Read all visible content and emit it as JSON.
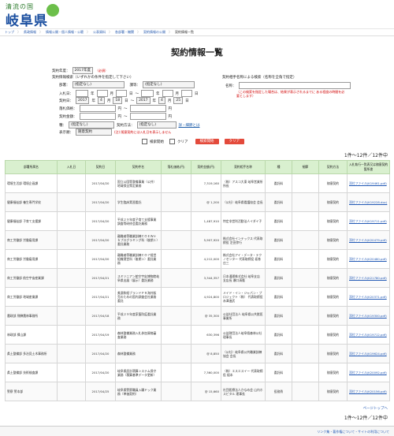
{
  "header": {
    "logo_small": "清流の国",
    "logo_big": "岐阜県"
  },
  "breadcrumb": [
    "トップ",
    "県政情報",
    "情報公開・個人情報・公聴",
    "公表資料",
    "各部署・機関",
    "契約情報の公開",
    "契約情報一覧"
  ],
  "page_title": "契約情報一覧",
  "form": {
    "year_label": "契約年度：",
    "year_value": "2017年度",
    "year_required": "（必須）",
    "cond_title": "契約情報検索（いずれかの条件を指定して下さい）",
    "dept_label": "部署：",
    "dept_value": "(指定なし)",
    "sect_label": "課等：",
    "sect_value": "(指定なし)",
    "enter_label": "入札日：",
    "contract_label": "契約日：",
    "date_from": [
      "2017",
      "4",
      "18"
    ],
    "date_to": [
      "2017",
      "4",
      "25"
    ],
    "year_unit": "年",
    "month_unit": "月",
    "day_unit": "日",
    "tilde": "〜",
    "bid_label": "落札価格：",
    "contract_amount_label": "契約金額：",
    "yen": "円",
    "type_label": "種：",
    "type_value": "(指定なし)",
    "method_label": "契約方法：",
    "method_value": "(指定なし)",
    "detail_link": "詳・細節とは",
    "sort_label": "表示順：",
    "sort_value": "随意契約",
    "sort_note": "(注) 随意契約には入札日を表示しません",
    "partner_title": "契約相手名称による検索（名称を全角で指定）",
    "partner_label": "名称：",
    "partner_note": "（この検索を指定した場合は、結果が表示されるまでに ある程度の時間を必要とします）",
    "check_search": "検索開始",
    "check_clear": "クリア",
    "search_button": "検索開始",
    "clear_button": "クリア"
  },
  "result_count": "1件〜12件／12件中",
  "table": {
    "headers": [
      "部署所属名",
      "入札日",
      "契約日",
      "契約件名",
      "落札価格(円)",
      "契約金額(円)",
      "契約相手名称",
      "種",
      "細節",
      "契約方法",
      "入札執行一覧表又は随意契約箇所書"
    ],
    "rows": [
      [
        "環境生活部 環境企画課",
        "",
        "2017/04/20",
        "国立公園等整備事業（公共）地域保全策定業務",
        "",
        "7,319,160",
        "（株）アスコ大東 岐阜営業所 所長",
        "委託料",
        "",
        "随意契約",
        "添付ファイル(K19461.pdf)"
      ],
      [
        "健康福祉部 養生専門学校",
        "",
        "2017/04/20",
        "学生臨床実習委託",
        "",
        "@ 1,200",
        "（公社）岐阜県看護協会 会長",
        "委託料",
        "",
        "随意契約",
        "添付ファイル(K19228.doc)"
      ],
      [
        "健康福祉部 子育て支援課",
        "",
        "2017/04/20",
        "平成２９年度子育て支援事業調査等研修会委託業務",
        "",
        "1,487,910",
        "特定非営利活動法人イダイ子",
        "委託料",
        "",
        "随意契約",
        "添付ファイル(K19711.pdf)"
      ],
      [
        "商工労働部 労働雇用課",
        "",
        "2017/04/20",
        "離職者等職業訓練ＣＯＥＷｅｂプログラミング科（後期１）委託業務",
        "",
        "5,907,920",
        "株式会社インテックス 代表取締役 芝田弥行",
        "委託料",
        "",
        "随意契約",
        "添付ファイル(K20479.pdf)"
      ],
      [
        "商工労働部 労働雇用課",
        "",
        "2017/04/20",
        "離職者等職業訓練ＣＯ７経営組織運営科（後期１）委託業務",
        "",
        "4,212,000",
        "株式会社アイ・データ・テクノセンター 代表取締役 坂巻庄三",
        "委託料",
        "",
        "随意契約",
        "添付ファイル(K20480.pdf)"
      ],
      [
        "商工労働部 航空宇宙産業課",
        "",
        "2017/04/21",
        "スミソニアン航空宇宙博物館岐阜県出展（展示）委託業務",
        "",
        "3,344,357",
        "日本通運株式会社 岐阜支店 支店長 瀬口清隆",
        "委託料",
        "",
        "随意契約",
        "添付ファイル(K21780.pdf)"
      ],
      [
        "商工労働部 地域産業課",
        "",
        "2017/04/21",
        "美濃和紙ブランドＰＲ海外販売のための国内調査会社業務委託",
        "",
        "4,924,800",
        "メイド・イン・ジャパン・プロジェクト（株） 代表取締役 赤澤進武",
        "委託料",
        "",
        "随意契約",
        "添付ファイル(K20371.pdf)"
      ],
      [
        "農政部 飛騨農林事務所",
        "",
        "2017/04/18",
        "平成２９年度家畜防疫委託業務",
        "",
        "@ 35,300",
        "公益社団法人 岐阜県公共獣医事業所",
        "委託料",
        "",
        "随意契約",
        "添付ファイル(K19300.pdf)"
      ],
      [
        "林政部 揖山課",
        "",
        "2017/04/19",
        "森林整備業務入札参加資格審査業務",
        "",
        "630,396",
        "公益財団法人岐阜県森林公社 理事長",
        "委託料",
        "",
        "随意契約",
        "添付ファイル(K19712.pdf)"
      ],
      [
        "県土整備部 多治見土木事務所",
        "",
        "2017/04/20",
        "森林整備業務",
        "",
        "@ 8,850",
        "（公社）岐阜県公共職業訓練協会 会長",
        "委託料",
        "",
        "随意契約",
        "添付ファイル(K19624.pdf)"
      ],
      [
        "県土整備部 技術検査課",
        "",
        "2017/04/20",
        "岐阜県設計積算システム保守業務（積算基準データ更新）",
        "",
        "7,360,000",
        "（株）エスエスイー 代表取締役 榎本",
        "委託料",
        "",
        "随意契約",
        "添付ファイル(K20092.pdf)"
      ],
      [
        "警察 警本部",
        "",
        "2017/04/25",
        "岐阜県警察職員入職ドック業務（単価契約）",
        "",
        "@ 15,660",
        "社団医療法人かなめ会 山内ホスピタル 理事長",
        "役務費",
        "",
        "随意契約",
        "添付ファイル(K20156.pdf)"
      ]
    ]
  },
  "page_top": "ページトップへ",
  "result_count_bottom": "1件〜12件／12件中",
  "footer": "リンク集・著作権について・サイトの利用について"
}
